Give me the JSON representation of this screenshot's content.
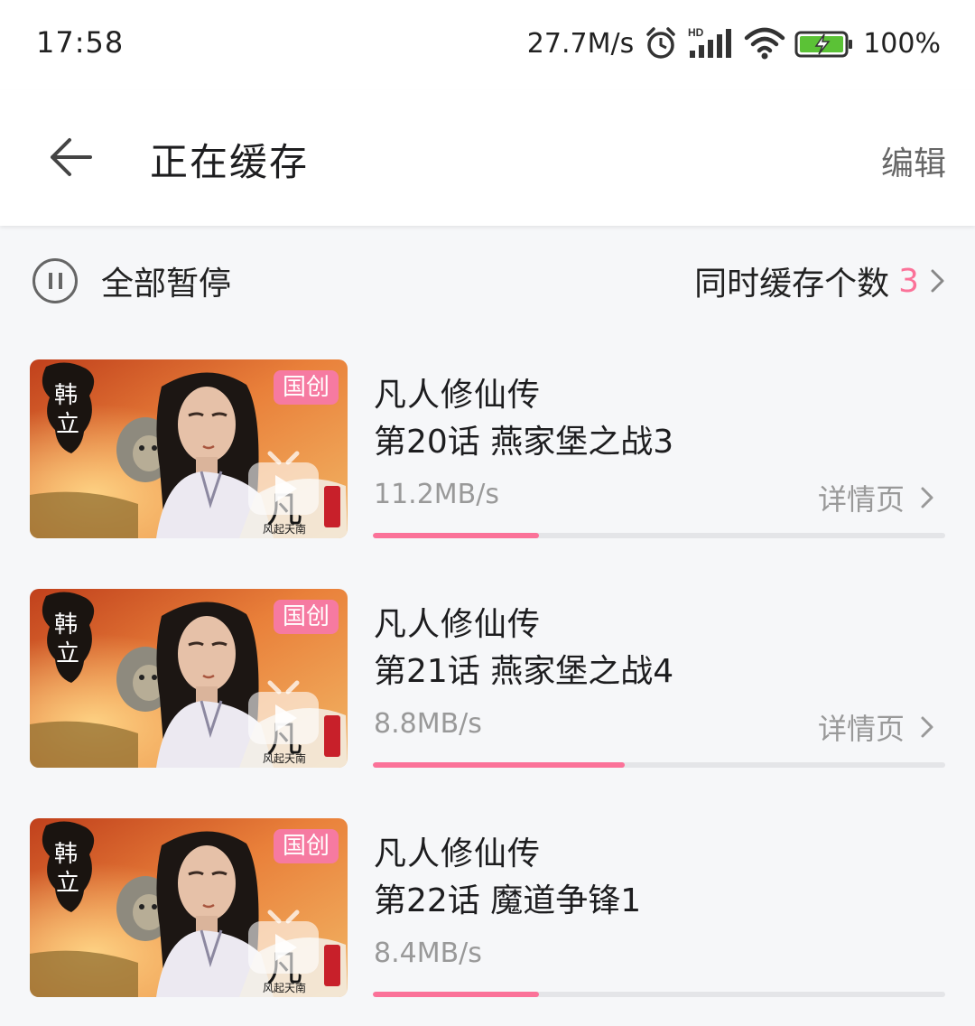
{
  "status_bar": {
    "time": "17:58",
    "network_speed": "27.7M/s",
    "network_type": "HD",
    "battery": "100%"
  },
  "header": {
    "title": "正在缓存",
    "edit_label": "编辑",
    "back_icon": "back-arrow-icon"
  },
  "controls": {
    "pause_all_label": "全部暂停",
    "concurrent_label": "同时缓存个数",
    "concurrent_count": "3"
  },
  "colors": {
    "accent": "#fb7299",
    "badge": "#f67aa1"
  },
  "downloads": [
    {
      "badge": "国创",
      "title": "凡人修仙传",
      "episode": "第20话 燕家堡之战3",
      "speed": "11.2MB/s",
      "detail_label": "详情页",
      "progress": 0.29
    },
    {
      "badge": "国创",
      "title": "凡人修仙传",
      "episode": "第21话 燕家堡之战4",
      "speed": "8.8MB/s",
      "detail_label": "详情页",
      "progress": 0.44
    },
    {
      "badge": "国创",
      "title": "凡人修仙传",
      "episode": "第22话 魔道争锋1",
      "speed": "8.4MB/s",
      "progress": 0.29
    }
  ]
}
